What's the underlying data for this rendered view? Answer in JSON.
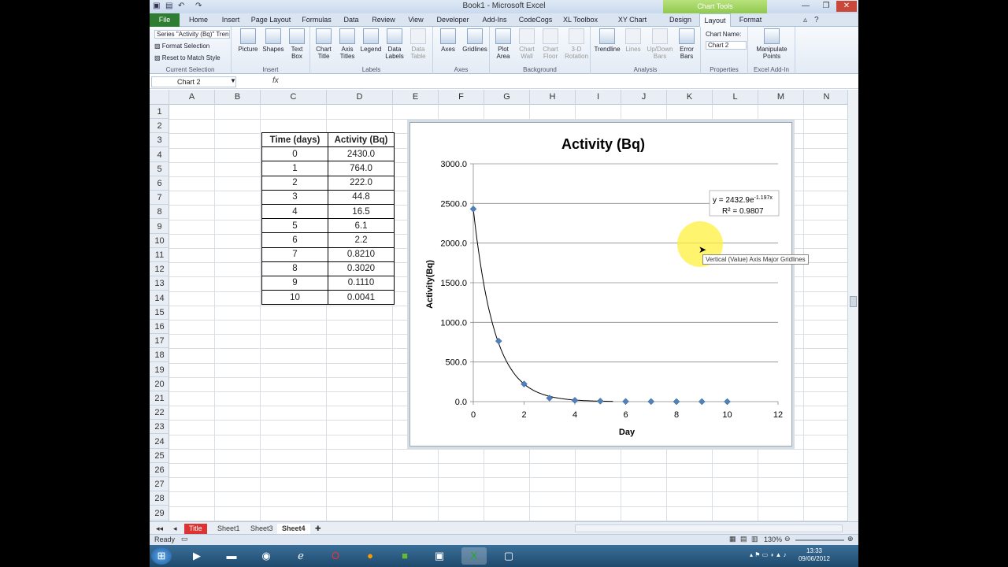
{
  "window": {
    "title": "Book1 - Microsoft Excel",
    "context_tools": "Chart Tools"
  },
  "tabs": [
    "File",
    "Home",
    "Insert",
    "Page Layout",
    "Formulas",
    "Data",
    "Review",
    "View",
    "Developer",
    "Add-Ins",
    "CodeCogs",
    "XL Toolbox",
    "XY Chart Labels",
    "Design",
    "Layout",
    "Format"
  ],
  "active_tab": "Layout",
  "ribbon": {
    "current_selection": {
      "dropdown": "Series \"Activity (Bq)\" Tren",
      "format_selection": "Format Selection",
      "reset": "Reset to Match Style",
      "label": "Current Selection"
    },
    "insert": {
      "buttons": [
        "Picture",
        "Shapes",
        "Text Box"
      ],
      "label": "Insert"
    },
    "labels": {
      "buttons": [
        "Chart Title",
        "Axis Titles",
        "Legend",
        "Data Labels",
        "Data Table"
      ],
      "label": "Labels"
    },
    "axes": {
      "buttons": [
        "Axes",
        "Gridlines"
      ],
      "label": "Axes"
    },
    "background": {
      "buttons": [
        "Plot Area",
        "Chart Wall",
        "Chart Floor",
        "3-D Rotation"
      ],
      "label": "Background"
    },
    "analysis": {
      "buttons": [
        "Trendline",
        "Lines",
        "Up/Down Bars",
        "Error Bars"
      ],
      "label": "Analysis"
    },
    "properties": {
      "chart_name_label": "Chart Name:",
      "chart_name": "Chart 2",
      "label": "Properties"
    },
    "excel_addin": {
      "buttons": [
        "Manipulate Points"
      ],
      "label": "Excel Add-In"
    }
  },
  "formula_bar": {
    "name_box": "Chart 2",
    "fx": "fx",
    "formula": ""
  },
  "columns": [
    "A",
    "B",
    "C",
    "D",
    "E",
    "F",
    "G",
    "H",
    "I",
    "J",
    "K",
    "L",
    "M",
    "N"
  ],
  "rows": [
    "1",
    "2",
    "3",
    "4",
    "5",
    "6",
    "7",
    "8",
    "9",
    "10",
    "11",
    "12",
    "13",
    "14",
    "15",
    "16",
    "17",
    "18",
    "19",
    "20",
    "21",
    "22",
    "23",
    "24",
    "25",
    "26",
    "27",
    "28",
    "29"
  ],
  "table": {
    "headers": [
      "Time (days)",
      "Activity (Bq)"
    ],
    "rows": [
      [
        "0",
        "2430.0"
      ],
      [
        "1",
        "764.0"
      ],
      [
        "2",
        "222.0"
      ],
      [
        "3",
        "44.8"
      ],
      [
        "4",
        "16.5"
      ],
      [
        "5",
        "6.1"
      ],
      [
        "6",
        "2.2"
      ],
      [
        "7",
        "0.8210"
      ],
      [
        "8",
        "0.3020"
      ],
      [
        "9",
        "0.1110"
      ],
      [
        "10",
        "0.0041"
      ]
    ]
  },
  "chart_data": {
    "type": "scatter",
    "title": "Activity (Bq)",
    "xlabel": "Day",
    "ylabel": "Activity(Bq)",
    "xlim": [
      0,
      12
    ],
    "ylim": [
      0,
      3000
    ],
    "x_ticks": [
      "0",
      "2",
      "4",
      "6",
      "8",
      "10",
      "12"
    ],
    "y_ticks": [
      "0.0",
      "500.0",
      "1000.0",
      "1500.0",
      "2000.0",
      "2500.0",
      "3000.0"
    ],
    "x": [
      0,
      1,
      2,
      3,
      4,
      5,
      6,
      7,
      8,
      9,
      10
    ],
    "y": [
      2430.0,
      764.0,
      222.0,
      44.8,
      16.5,
      6.1,
      2.2,
      0.821,
      0.302,
      0.111,
      0.0041
    ],
    "trendline": {
      "type": "exponential",
      "a": 2432.9,
      "b": -1.197,
      "x_end": 5.5
    },
    "equation": "y = 2432.9e",
    "equation_exp": "-1.197x",
    "r2": "R² = 0.9807",
    "grid": true,
    "marker_color": "#4f81bd"
  },
  "tooltip": "Vertical (Value) Axis Major Gridlines",
  "sheet_tabs": [
    "Title",
    "Sheet1",
    "Sheet3",
    "Sheet4"
  ],
  "active_sheet": "Sheet4",
  "status": {
    "ready": "Ready",
    "zoom": "130%"
  },
  "clock": {
    "time": "13:33",
    "date": "09/06/2012"
  }
}
